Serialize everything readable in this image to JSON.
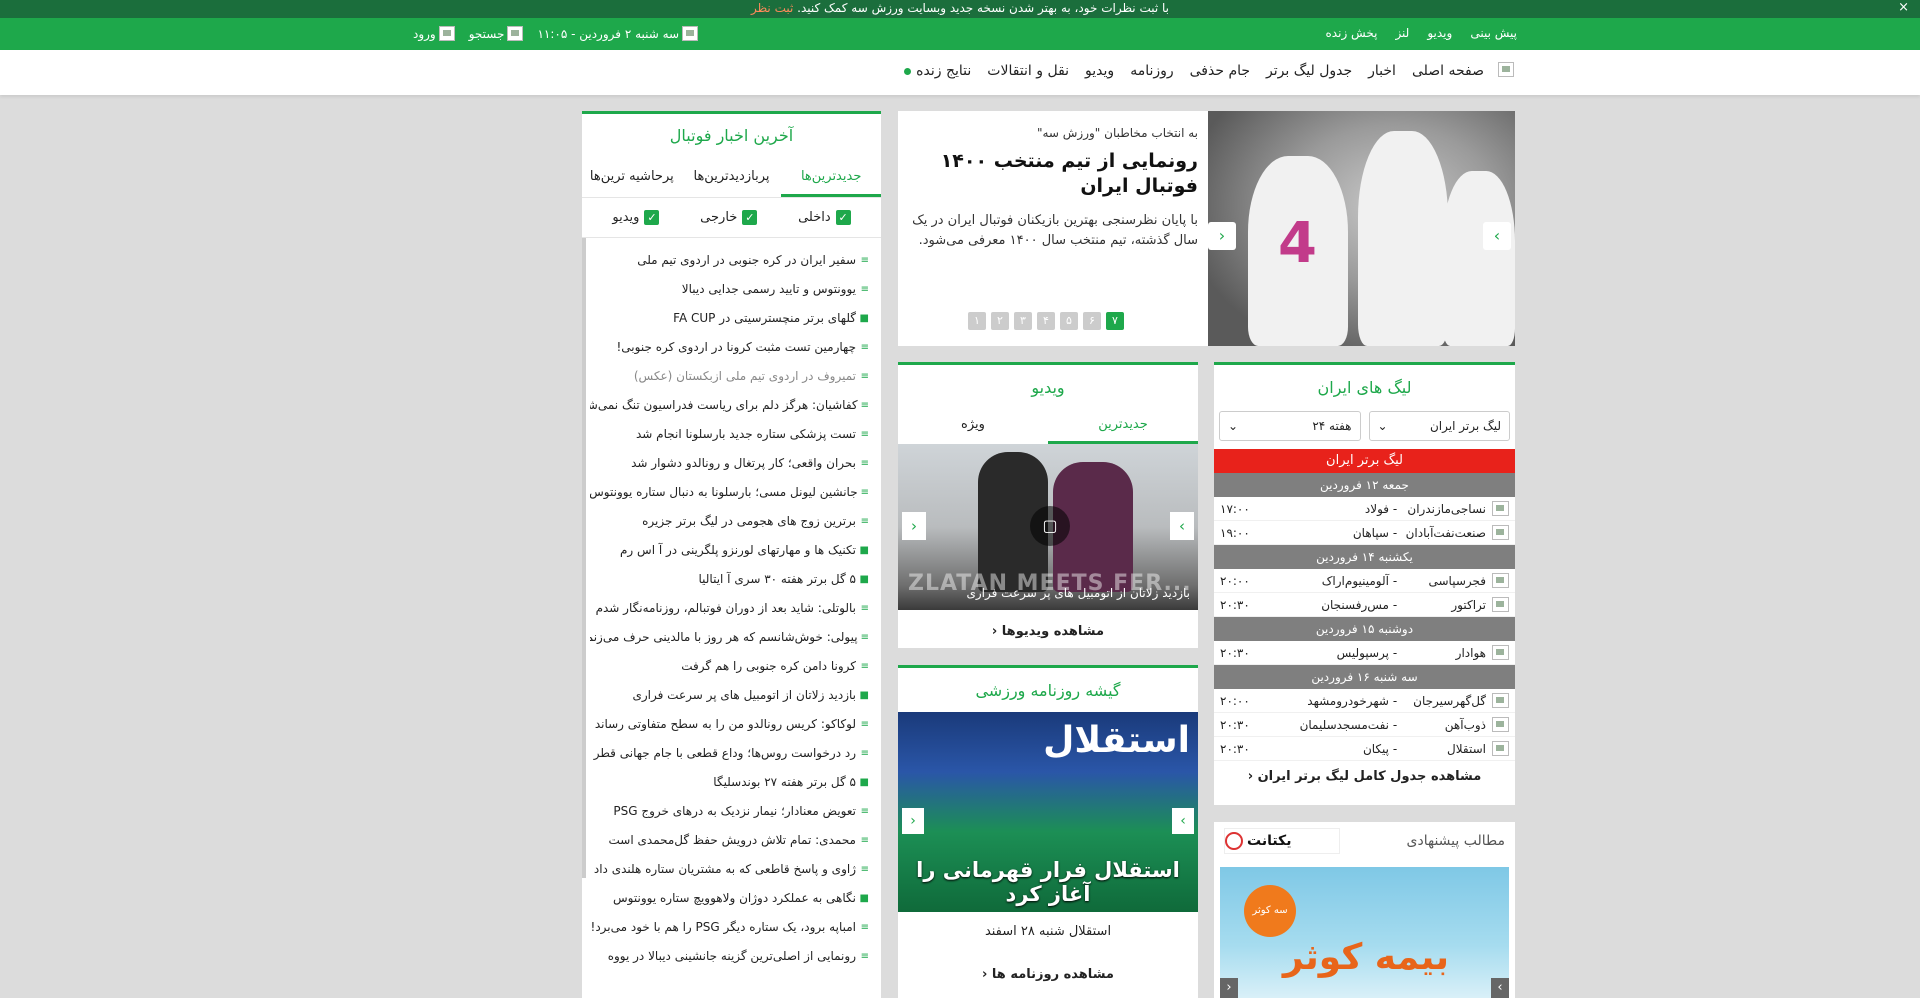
{
  "notice": {
    "message": "با ثبت نظرات خود، به بهتر شدن نسخه جدید وبسایت ورزش سه کمک کنید.",
    "link": "ثبت نظر",
    "close": "×"
  },
  "topbar": {
    "links": [
      "پیش بینی",
      "ویدیو",
      "لنز",
      "پخش زنده"
    ],
    "datetime": "سه شنبه ۲ فروردین - ۱۱:۰۵",
    "search": "جستجو",
    "login": "ورود"
  },
  "nav": {
    "items": [
      "صفحه اصلی",
      "اخبار",
      "جدول لیگ برتر",
      "جام حذفی",
      "روزنامه",
      "ویدیو",
      "نقل و انتقالات",
      "نتایج زنده"
    ]
  },
  "slider": {
    "kicker": "به انتخاب مخاطبان \"ورزش سه\"",
    "headline": "رونمایی از تیم منتخب ۱۴۰۰ فوتبال ایران",
    "summary": "با پایان نظرسنجی بهترین بازیکنان فوتبال ایران در یک سال گذشته، تیم منتخب سال ۱۴۰۰ معرفی می‌شود.",
    "jersey_number": "4",
    "dots": [
      "۷",
      "۶",
      "۵",
      "۴",
      "۳",
      "۲",
      "۱"
    ],
    "active_dot": "۷"
  },
  "news": {
    "title": "آخرین اخبار فوتبال",
    "tabs": [
      "جدیدترین‌ها",
      "پربازدیدترین‌ها",
      "پرحاشیه ترین‌ها"
    ],
    "filters": [
      "داخلی",
      "خارجی",
      "ویدیو"
    ],
    "items": [
      {
        "text": "سفیر ایران در کره جنوبی در اردوی تیم ملی",
        "icon": "list-icon"
      },
      {
        "text": "یوونتوس و تایید رسمی جدایی دیبالا",
        "icon": "list-icon"
      },
      {
        "text": "گلهای برتر منچسترسیتی در FA CUP",
        "icon": "video-icon"
      },
      {
        "text": "چهارمین تست مثبت کرونا در اردوی کره جنوبی!",
        "icon": "list-icon"
      },
      {
        "text": "تمیروف در اردوی تیم ملی ازبکستان (عکس)",
        "icon": "list-icon",
        "dim": true
      },
      {
        "text": "کفاشیان: هرگز دلم برای ریاست فدراسیون تنگ نمی‌شود",
        "icon": "list-icon"
      },
      {
        "text": "تست پزشکی ستاره جدید بارسلونا انجام شد",
        "icon": "list-icon"
      },
      {
        "text": "بحران واقعی؛ کار پرتغال و رونالدو دشوار شد",
        "icon": "list-icon"
      },
      {
        "text": "جانشین لیونل مسی؛ بارسلونا به دنبال ستاره یوونتوس",
        "icon": "list-icon"
      },
      {
        "text": "برترین زوج های هجومی در لیگ برتر جزیره",
        "icon": "list-icon"
      },
      {
        "text": "تکنیک ها و مهارتهای لورنزو پلگرینی در آ اس رم",
        "icon": "video-icon"
      },
      {
        "text": "۵ گل برتر هفته ۳۰ سری آ ایتالیا",
        "icon": "video-icon"
      },
      {
        "text": "بالوتلی: شاید بعد از دوران فوتبالم، روزنامه‌نگار شدم",
        "icon": "list-icon"
      },
      {
        "text": "پیولی: خوش‌شانسم که هر روز با مالدینی حرف می‌زنم",
        "icon": "list-icon"
      },
      {
        "text": "کرونا دامن کره جنوبی را هم گرفت",
        "icon": "list-icon"
      },
      {
        "text": "بازدید زلاتان از اتومبیل های پر سرعت فراری",
        "icon": "video-icon"
      },
      {
        "text": "لوکاکو: کریس رونالدو من را به سطح متفاوتی رساند",
        "icon": "list-icon"
      },
      {
        "text": "رد درخواست روس‌ها؛ وداع قطعی با جام جهانی قطر",
        "icon": "list-icon"
      },
      {
        "text": "۵ گل برتر هفته ۲۷ بوندسلیگا",
        "icon": "video-icon"
      },
      {
        "text": "تعویض معنادار؛ نیمار نزدیک به درهای خروج PSG",
        "icon": "list-icon"
      },
      {
        "text": "محمدی: تمام تلاش درویش حفظ گل‌محمدی است",
        "icon": "list-icon"
      },
      {
        "text": "ژاوی و پاسخ قاطعی که به مشتریان ستاره هلندی داد",
        "icon": "list-icon"
      },
      {
        "text": "نگاهی به عملکرد دوژان ولاهوویچ ستاره یوونتوس",
        "icon": "video-icon"
      },
      {
        "text": "امباپه برود، یک ستاره دیگر PSG را هم با خود می‌برد!",
        "icon": "list-icon"
      },
      {
        "text": "رونمایی از اصلی‌ترین گزینه جانشینی دیبالا در یووه",
        "icon": "list-icon"
      }
    ]
  },
  "league": {
    "title": "لیگ های ایران",
    "select_league": "لیگ برتر ایران",
    "select_week": "هفته ۲۴",
    "header": "لیگ برتر ایران",
    "days": [
      {
        "day": "جمعه ۱۲ فروردین",
        "matches": [
          {
            "home": "نساجی‌مازندران",
            "away": "فولاد",
            "time": "۱۷:۰۰"
          },
          {
            "home": "صنعت‌نفت‌آبادان",
            "away": "سپاهان",
            "time": "۱۹:۰۰"
          }
        ]
      },
      {
        "day": "یکشنبه ۱۴ فروردین",
        "matches": [
          {
            "home": "فجرسپاسی",
            "away": "آلومینیوم‌اراک",
            "time": "۲۰:۰۰"
          },
          {
            "home": "تراکتور",
            "away": "مس‌رفسنجان",
            "time": "۲۰:۳۰"
          }
        ]
      },
      {
        "day": "دوشنبه ۱۵ فروردین",
        "matches": [
          {
            "home": "هوادار",
            "away": "پرسپولیس",
            "time": "۲۰:۳۰"
          }
        ]
      },
      {
        "day": "سه شنبه ۱۶ فروردین",
        "matches": [
          {
            "home": "گل‌گهرسیرجان",
            "away": "شهرخودرومشهد",
            "time": "۲۰:۰۰"
          },
          {
            "home": "ذوب‌آهن",
            "away": "نفت‌مسجدسلیمان",
            "time": "۲۰:۳۰"
          },
          {
            "home": "استقلال",
            "away": "پیکان",
            "time": "۲۰:۳۰"
          }
        ]
      }
    ],
    "separator": "-",
    "more": "مشاهده جدول کامل لیگ برتر ایران"
  },
  "video": {
    "title": "ویدیو",
    "tabs": [
      "جدیدترین",
      "ویژه"
    ],
    "watermark": "ZLATAN MEETS FER...",
    "caption": "بازدید زلاتان از اتومبیل های پر سرعت فراری",
    "more": "مشاهده ویدیوها"
  },
  "paper": {
    "title": "گیشه روزنامه ورزشی",
    "masthead": "استقلال",
    "headline": "استقلال فرار قهرمانی را آغاز کرد",
    "caption": "استقلال شنبه ۲۸ اسفند",
    "more": "مشاهده روزنامه ها"
  },
  "suggested": {
    "title": "مطالب پیشنهادی",
    "brand": "یکتانت",
    "ad_title": "بیمه کوثر",
    "ad_logo": "سه کوثر"
  },
  "colors": {
    "accent": "#1ea84b",
    "accent_dark": "#1b6e3c",
    "league_header": "#e8221b",
    "day_header": "#7f7f7f"
  }
}
